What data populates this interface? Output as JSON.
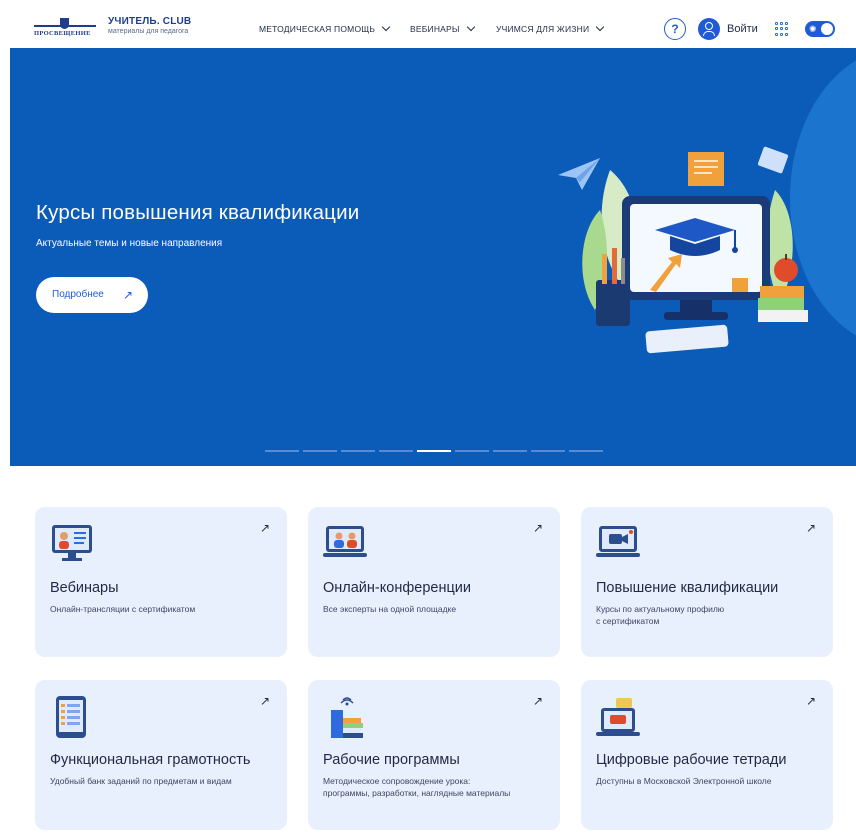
{
  "header": {
    "logo_word": "ПРОСВЕЩЕНИЕ",
    "site_title": "УЧИТЕЛЬ. CLUB",
    "site_subtitle": "материалы для педагога",
    "nav": [
      "МЕТОДИЧЕСКАЯ ПОМОЩЬ",
      "ВЕБИНАРЫ",
      "УЧИМСЯ ДЛЯ ЖИЗНИ"
    ],
    "help_label": "?",
    "login_label": "Войти"
  },
  "hero": {
    "title": "Курсы повышения квалификации",
    "subtitle": "Актуальные темы и новые направления",
    "button_label": "Подробнее",
    "slide_count": 9,
    "active_slide": 5
  },
  "cards": [
    {
      "title": "Вебинары",
      "desc": "Онлайн-трансляции с сертификатом",
      "icon": "webinar-icon"
    },
    {
      "title": "Онлайн-конференции",
      "desc": "Все эксперты на одной площадке",
      "icon": "conference-icon"
    },
    {
      "title": "Повышение квалификации",
      "desc": "Курсы по актуальному профилю\nс сертификатом",
      "icon": "video-course-icon"
    },
    {
      "title": "Функциональная грамотность",
      "desc": "Удобный банк заданий по предметам и видам",
      "icon": "tablet-icon"
    },
    {
      "title": "Рабочие программы",
      "desc": "Методическое сопровождение урока:\nпрограммы, разработки, наглядные материалы",
      "icon": "books-icon"
    },
    {
      "title": "Цифровые рабочие тетради",
      "desc": "Доступны в Московской Электронной школе",
      "icon": "laptop-icon"
    }
  ],
  "colors": {
    "accent": "#1f5bd6",
    "hero_bg": "#0b5bb8",
    "card_bg": "#e8effd"
  }
}
